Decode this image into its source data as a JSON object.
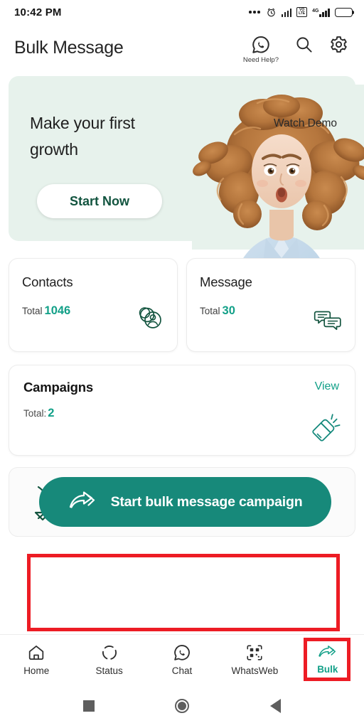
{
  "status_bar": {
    "time": "10:42 PM",
    "icons": [
      "more-dots-icon",
      "alarm-icon",
      "signal-bars-icon",
      "volte-icon",
      "4g-signal-icon",
      "battery-icon"
    ],
    "volte_line1": "VO",
    "volte_line2": "LTE",
    "network_label": "4G"
  },
  "header": {
    "title": "Bulk Message",
    "need_help_label": "Need Help?",
    "actions": [
      "whatsapp-help-icon",
      "search-icon",
      "gear-icon"
    ]
  },
  "promo": {
    "title": "Make your first growth",
    "watch_demo_label": "Watch Demo",
    "start_now_label": "Start Now",
    "background_color": "#e7f2ec",
    "image": "woman-surprised-photo"
  },
  "stats": [
    {
      "title": "Contacts",
      "total_label": "Total",
      "total_value": "1046",
      "icon": "contacts-icon"
    },
    {
      "title": "Message",
      "total_label": "Total",
      "total_value": "30",
      "icon": "chat-bubbles-icon"
    }
  ],
  "campaigns": {
    "title": "Campaigns",
    "view_label": "View",
    "total_label": "Total:",
    "total_value": "2",
    "icon": "megaphone-icon"
  },
  "cta": {
    "label": "Start bulk message campaign",
    "icon": "double-arrow-icon",
    "color": "#17897a"
  },
  "bottom_nav": {
    "items": [
      {
        "label": "Home",
        "icon": "home-icon",
        "active": false
      },
      {
        "label": "Status",
        "icon": "status-ring-icon",
        "active": false
      },
      {
        "label": "Chat",
        "icon": "whatsapp-chat-icon",
        "active": false
      },
      {
        "label": "WhatsWeb",
        "icon": "qr-code-icon",
        "active": false
      },
      {
        "label": "Bulk",
        "icon": "double-arrow-icon",
        "active": true
      }
    ],
    "active_color": "#12a088"
  },
  "system_nav": {
    "buttons": [
      "recents-square-icon",
      "home-circle-icon",
      "back-triangle-icon"
    ]
  },
  "annotations": {
    "accent_color": "#ed1c24",
    "boxes": [
      "cta-highlight",
      "bulk-tab-highlight"
    ]
  },
  "theme": {
    "accent": "#12a088",
    "button": "#17897a",
    "dark_green": "#12543f"
  }
}
